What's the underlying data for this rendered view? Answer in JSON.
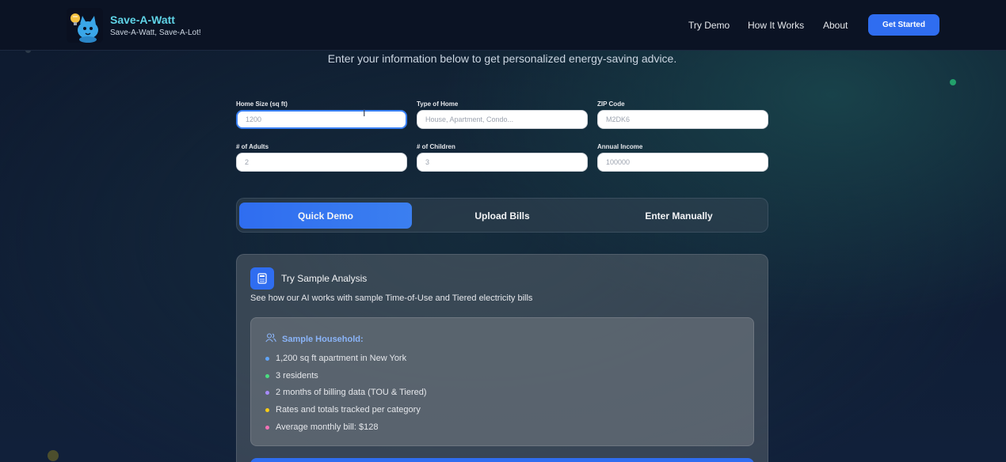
{
  "nav": {
    "brand_name": "Save-A-Watt",
    "brand_tagline": "Save-A-Watt, Save-A-Lot!",
    "links": [
      "Try Demo",
      "How It Works",
      "About"
    ],
    "cta": "Get Started"
  },
  "intro": "Enter your information below to get personalized energy-saving advice.",
  "form": {
    "home_size": {
      "label": "Home Size (sq ft)",
      "placeholder": "1200"
    },
    "home_type": {
      "label": "Type of Home",
      "placeholder": "House, Apartment, Condo..."
    },
    "zip": {
      "label": "ZIP Code",
      "placeholder": "M2DK6"
    },
    "adults": {
      "label": "# of Adults",
      "placeholder": "2"
    },
    "children": {
      "label": "# of Children",
      "placeholder": "3"
    },
    "income": {
      "label": "Annual Income",
      "placeholder": "100000"
    }
  },
  "tabs": [
    "Quick Demo",
    "Upload Bills",
    "Enter Manually"
  ],
  "active_tab": "Quick Demo",
  "sample": {
    "title": "Try Sample Analysis",
    "description": "See how our AI works with sample Time-of-Use and Tiered electricity bills",
    "household_title": "Sample Household:",
    "items": [
      {
        "text": "1,200 sq ft apartment in New York",
        "color": "#60a5fa"
      },
      {
        "text": "3 residents",
        "color": "#4ade80"
      },
      {
        "text": "2 months of billing data (TOU & Tiered)",
        "color": "#a78bfa"
      },
      {
        "text": "Rates and totals tracked per category",
        "color": "#facc15"
      },
      {
        "text": "Average monthly bill: $128",
        "color": "#f472b6"
      }
    ]
  },
  "colors": {
    "accent": "#2f6df0",
    "brand": "#5fd3e6",
    "nav_bg": "#0b1324"
  },
  "icons": {
    "logo": "lightbulb-cat-logo",
    "card": "calculator-icon",
    "household": "users-icon"
  }
}
